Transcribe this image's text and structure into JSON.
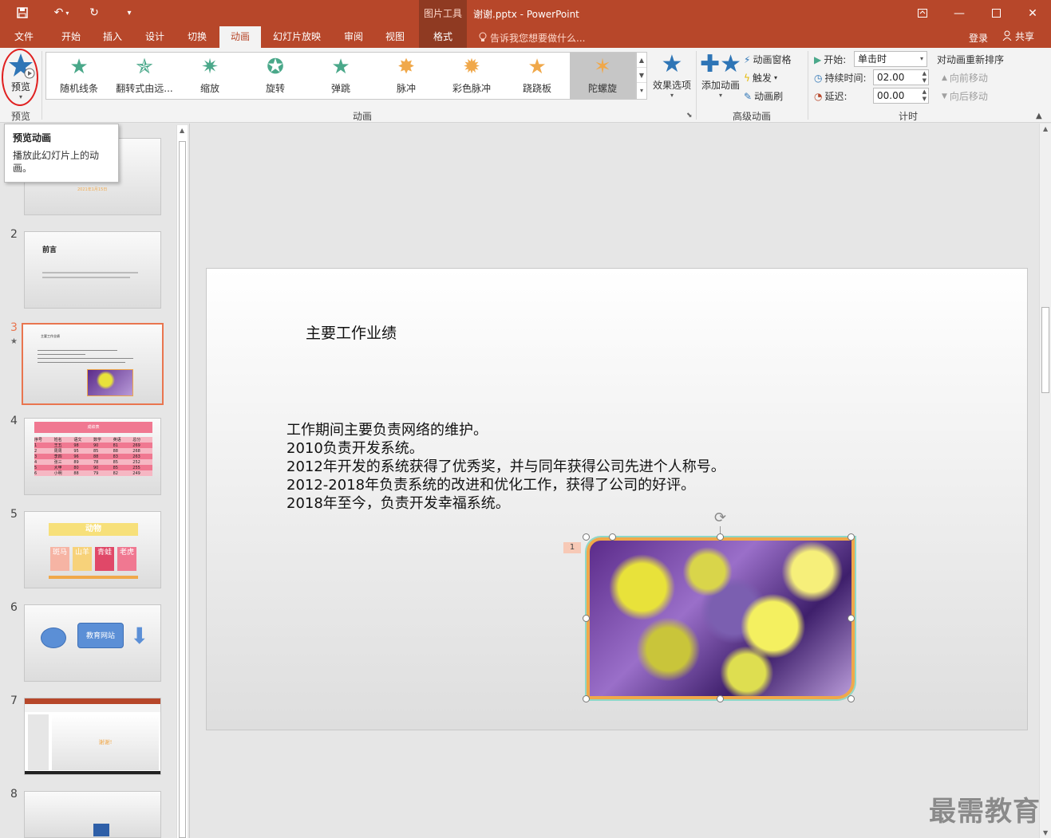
{
  "colors": {
    "brand": "#b7472a",
    "ribbon_bg": "#f3f3f3",
    "selection_border": "#e9754f",
    "highlight_circle": "#e02020"
  },
  "titlebar": {
    "context_tools": "图片工具",
    "doc_title": "谢谢.pptx - PowerPoint",
    "qa_icons": [
      "save-icon",
      "undo-icon",
      "redo-icon",
      "customize-icon"
    ]
  },
  "tabs": {
    "file": "文件",
    "home": "开始",
    "insert": "插入",
    "design": "设计",
    "transitions": "切换",
    "animations": "动画",
    "slideshow": "幻灯片放映",
    "review": "审阅",
    "view": "视图",
    "format": "格式",
    "tellme": "告诉我您想要做什么...",
    "signin": "登录",
    "share": "共享"
  },
  "ribbon": {
    "preview": {
      "label": "预览",
      "group": "预览"
    },
    "gallery": {
      "group": "动画",
      "items": [
        "随机线条",
        "翻转式由远...",
        "缩放",
        "旋转",
        "弹跳",
        "脉冲",
        "彩色脉冲",
        "跷跷板",
        "陀螺旋"
      ],
      "selected": "陀螺旋"
    },
    "effect_options": "效果选项",
    "advanced": {
      "group": "高级动画",
      "add_animation": "添加动画",
      "animation_pane": "动画窗格",
      "trigger": "触发",
      "painter": "动画刷"
    },
    "timing": {
      "group": "计时",
      "start_label": "开始:",
      "start_value": "单击时",
      "duration_label": "持续时间:",
      "duration_value": "02.00",
      "delay_label": "延迟:",
      "delay_value": "00.00",
      "reorder": "对动画重新排序",
      "move_earlier": "向前移动",
      "move_later": "向后移动"
    }
  },
  "tooltip": {
    "title": "预览动画",
    "body": "播放此幻灯片上的动画。"
  },
  "thumbnails": {
    "numbers": [
      "2",
      "3",
      "4",
      "5",
      "6",
      "7",
      "8"
    ],
    "slide1_date": "2021年1月15日",
    "slide2_title": "前言",
    "slide3_title": "主要工作业绩",
    "slide4_title": "成绩表",
    "slide4_headers": [
      "序号",
      "姓名",
      "语文",
      "数学",
      "英语",
      "总分"
    ],
    "slide4_rows": [
      [
        "1",
        "王五",
        "98",
        "90",
        "81",
        "269"
      ],
      [
        "2",
        "周周",
        "95",
        "85",
        "88",
        "268"
      ],
      [
        "3",
        "李四",
        "96",
        "88",
        "83",
        "263"
      ],
      [
        "4",
        "张三",
        "89",
        "78",
        "85",
        "252"
      ],
      [
        "5",
        "大甲",
        "80",
        "90",
        "85",
        "255"
      ],
      [
        "6",
        "小明",
        "88",
        "79",
        "82",
        "249"
      ]
    ],
    "slide5_title": "动物",
    "slide5_cards": [
      "斑马",
      "山羊",
      "青蛙",
      "老虎"
    ],
    "slide6_button": "教育网站",
    "slide7_text": "谢谢!"
  },
  "slide": {
    "title": "主要工作业绩",
    "lines": [
      "工作期间主要负责网络的维护。",
      "2010负责开发系统。",
      "2012年开发的系统获得了优秀奖，并与同年获得公司先进个人称号。",
      "2012-2018年负责系统的改进和优化工作，获得了公司的好评。",
      "2018年至今，负责开发幸福系统。"
    ],
    "anim_tag": "1"
  },
  "watermark": "最需教育"
}
